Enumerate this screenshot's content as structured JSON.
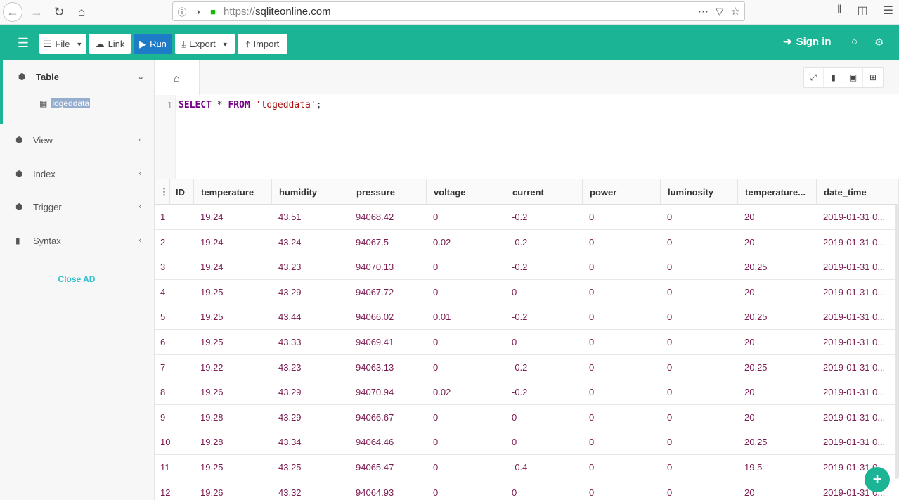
{
  "browser": {
    "url_proto": "https://",
    "url_host": "sqliteonline.com"
  },
  "toolbar": {
    "file_label": "File",
    "link_label": "Link",
    "run_label": "Run",
    "export_label": "Export",
    "import_label": "Import",
    "signin_label": "Sign in"
  },
  "sidebar": {
    "table_label": "Table",
    "table_item": "logeddata",
    "view_label": "View",
    "index_label": "Index",
    "trigger_label": "Trigger",
    "syntax_label": "Syntax",
    "close_ad": "Close AD"
  },
  "editor": {
    "line_number": "1",
    "kw_select": "SELECT",
    "star": " * ",
    "kw_from": "FROM",
    "table_string": " 'logeddata'",
    "semicolon": ";"
  },
  "grid": {
    "columns": [
      "ID",
      "temperature",
      "humidity",
      "pressure",
      "voltage",
      "current",
      "power",
      "luminosity",
      "temperature...",
      "date_time"
    ],
    "rows": [
      [
        "1",
        "19.24",
        "43.51",
        "94068.42",
        "0",
        "-0.2",
        "0",
        "0",
        "20",
        "2019-01-31 0..."
      ],
      [
        "2",
        "19.24",
        "43.24",
        "94067.5",
        "0.02",
        "-0.2",
        "0",
        "0",
        "20",
        "2019-01-31 0..."
      ],
      [
        "3",
        "19.24",
        "43.23",
        "94070.13",
        "0",
        "-0.2",
        "0",
        "0",
        "20.25",
        "2019-01-31 0..."
      ],
      [
        "4",
        "19.25",
        "43.29",
        "94067.72",
        "0",
        "0",
        "0",
        "0",
        "20",
        "2019-01-31 0..."
      ],
      [
        "5",
        "19.25",
        "43.44",
        "94066.02",
        "0.01",
        "-0.2",
        "0",
        "0",
        "20.25",
        "2019-01-31 0..."
      ],
      [
        "6",
        "19.25",
        "43.33",
        "94069.41",
        "0",
        "0",
        "0",
        "0",
        "20",
        "2019-01-31 0..."
      ],
      [
        "7",
        "19.22",
        "43.23",
        "94063.13",
        "0",
        "-0.2",
        "0",
        "0",
        "20.25",
        "2019-01-31 0..."
      ],
      [
        "8",
        "19.26",
        "43.29",
        "94070.94",
        "0.02",
        "-0.2",
        "0",
        "0",
        "20",
        "2019-01-31 0..."
      ],
      [
        "9",
        "19.28",
        "43.29",
        "94066.67",
        "0",
        "0",
        "0",
        "0",
        "20",
        "2019-01-31 0..."
      ],
      [
        "10",
        "19.28",
        "43.34",
        "94064.46",
        "0",
        "0",
        "0",
        "0",
        "20.25",
        "2019-01-31 0..."
      ],
      [
        "11",
        "19.25",
        "43.25",
        "94065.47",
        "0",
        "-0.4",
        "0",
        "0",
        "19.5",
        "2019-01-31 0..."
      ],
      [
        "12",
        "19.26",
        "43.32",
        "94064.93",
        "0",
        "0",
        "0",
        "0",
        "20",
        "2019-01-31 0..."
      ]
    ]
  },
  "colors": {
    "accent": "#1bb494",
    "run_button": "#1e7bc7",
    "cell_text": "#7b1a4f"
  }
}
